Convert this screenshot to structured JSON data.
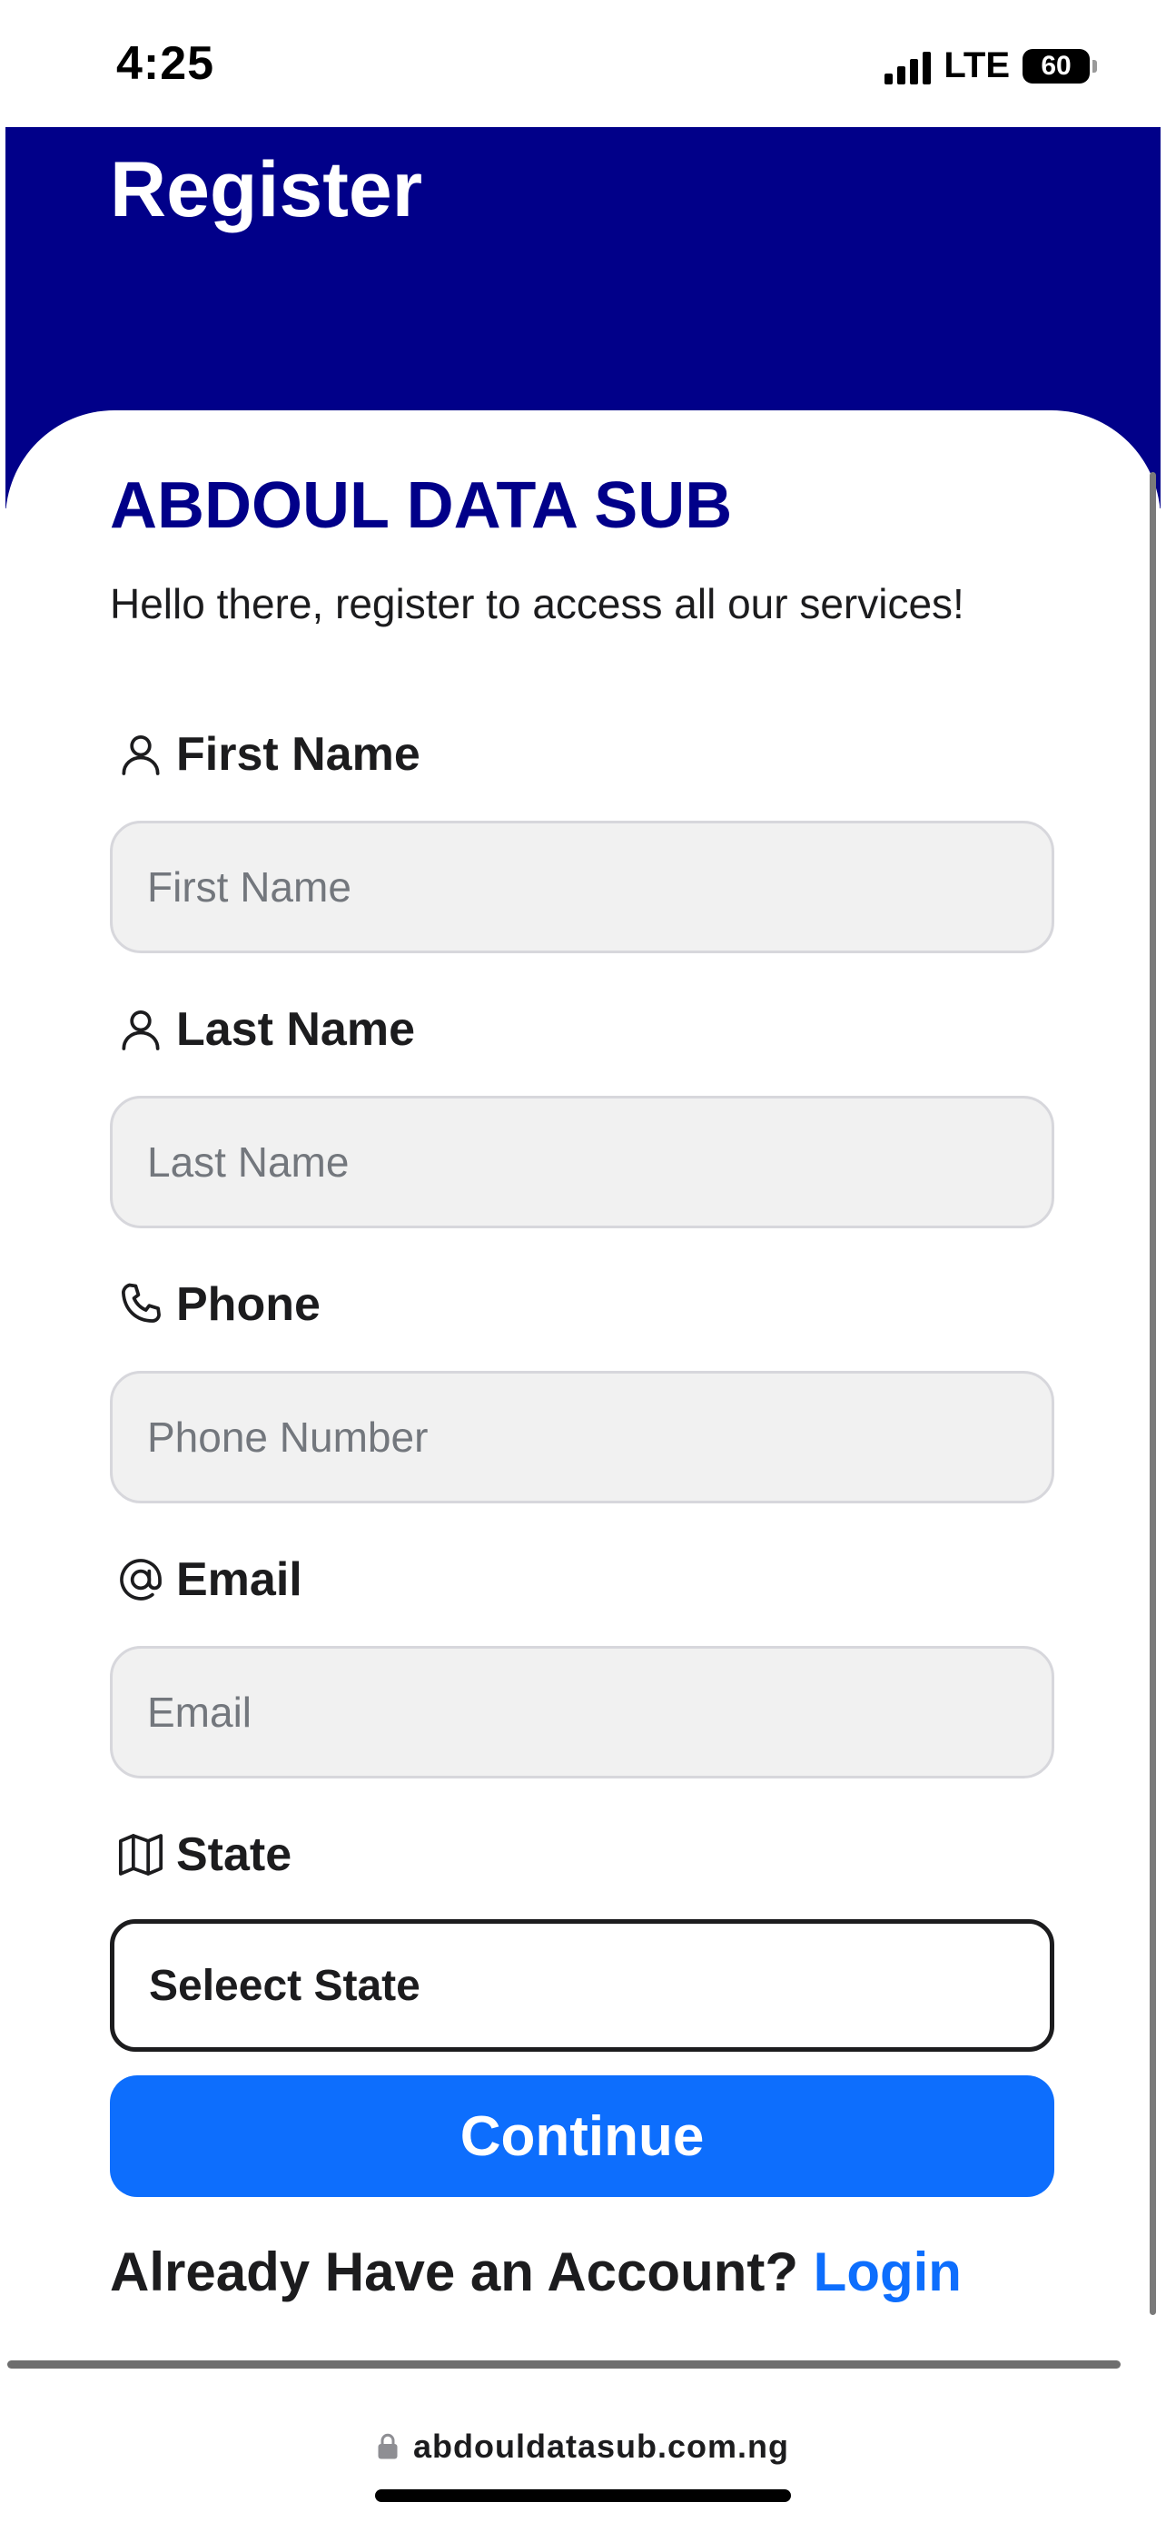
{
  "status_bar": {
    "time": "4:25",
    "network": "LTE",
    "battery": "60"
  },
  "header": {
    "title": "Register"
  },
  "brand": {
    "title": "ABDOUL DATA SUB",
    "subtitle": "Hello there, register to access all our services!"
  },
  "form": {
    "first_name": {
      "label": "First Name",
      "placeholder": "First Name",
      "icon": "user-icon"
    },
    "last_name": {
      "label": "Last Name",
      "placeholder": "Last Name",
      "icon": "user-icon"
    },
    "phone": {
      "label": "Phone",
      "placeholder": "Phone Number",
      "icon": "phone-icon"
    },
    "email": {
      "label": "Email",
      "placeholder": "Email",
      "icon": "at-icon"
    },
    "state": {
      "label": "State",
      "selected": "Seleect State",
      "icon": "map-icon"
    },
    "submit_label": "Continue"
  },
  "footer": {
    "prompt": "Already Have an Account?",
    "login_label": "Login"
  },
  "browser": {
    "url": "abdouldatasub.com.ng"
  },
  "colors": {
    "header_bg": "#010089",
    "brand": "#010089",
    "accent": "#0d6efd"
  }
}
